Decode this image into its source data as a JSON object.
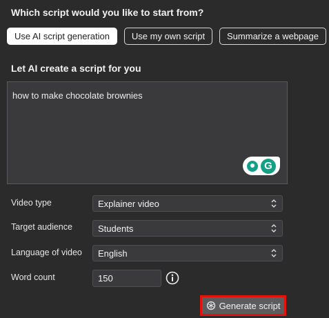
{
  "heading": "Which script would you like to start from?",
  "modes": [
    {
      "label": "Use AI script generation",
      "active": true
    },
    {
      "label": "Use my own script",
      "active": false
    },
    {
      "label": "Summarize a webpage",
      "active": false
    }
  ],
  "section_title": "Let AI create a script for you",
  "prompt": {
    "value": "how to make chocolate brownies"
  },
  "grammarly": {
    "icons": [
      "lightbulb-icon",
      "grammarly-logo-icon"
    ],
    "logo_letter": "G"
  },
  "fields": {
    "video_type": {
      "label": "Video type",
      "value": "Explainer video"
    },
    "target_audience": {
      "label": "Target audience",
      "value": "Students"
    },
    "language": {
      "label": "Language of video",
      "value": "English"
    },
    "word_count": {
      "label": "Word count",
      "value": "150"
    }
  },
  "generate_button": {
    "label": "Generate script",
    "icon": "openai-icon",
    "highlight_color": "#e3120b"
  }
}
